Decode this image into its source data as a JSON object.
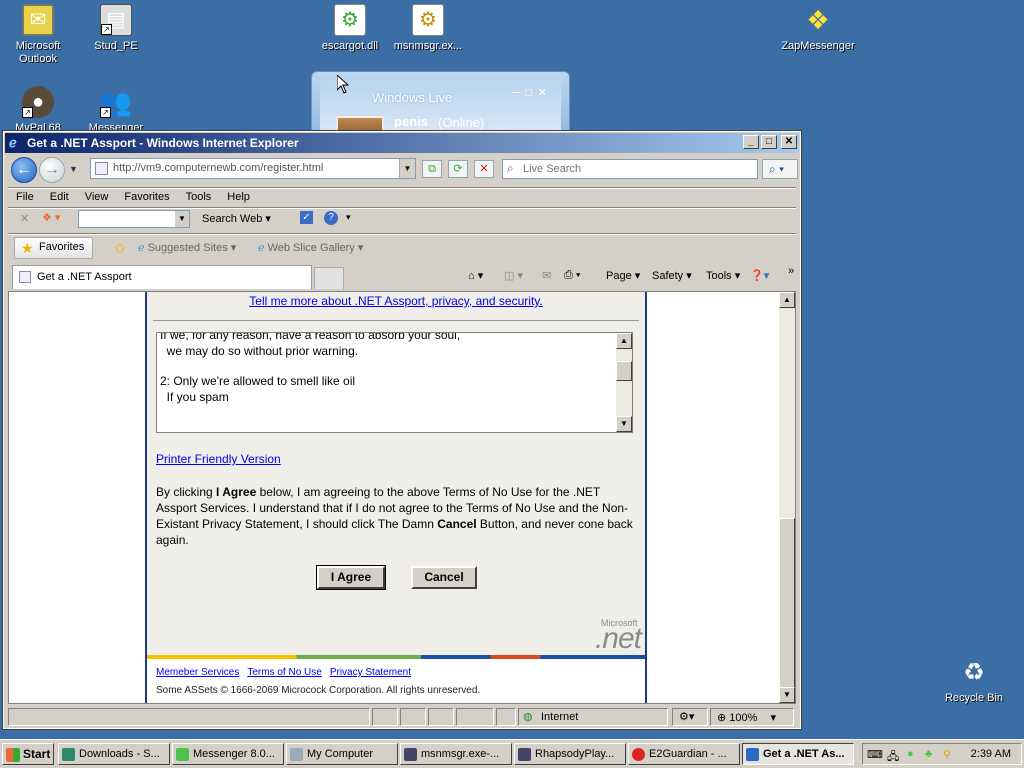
{
  "desktop": {
    "icons": [
      {
        "label": "Microsoft Outlook",
        "icon": "outlook-icon"
      },
      {
        "label": "Stud_PE",
        "icon": "stud-pe-icon"
      },
      {
        "label": "escargot.dll",
        "icon": "dll-file-icon"
      },
      {
        "label": "msnmsgr.ex...",
        "icon": "exe-file-icon"
      },
      {
        "label": "ZapMessenger",
        "icon": "zapmessenger-icon"
      },
      {
        "label": "MyPal 68",
        "icon": "mypal-icon"
      },
      {
        "label": "Messenger",
        "icon": "messenger-icon"
      },
      {
        "label": "Recycle Bin",
        "icon": "recycle-bin-icon"
      }
    ]
  },
  "messenger_window": {
    "title": "Windows Live",
    "user_name": "penis",
    "status": "(Online)"
  },
  "ie": {
    "title": "Get a .NET Assport - Windows Internet Explorer",
    "address": "http://vm9.computernewb.com/register.html",
    "search_placeholder": "Live Search",
    "menu": [
      "File",
      "Edit",
      "View",
      "Favorites",
      "Tools",
      "Help"
    ],
    "toolbar": {
      "search_web": "Search Web"
    },
    "favorites": {
      "label": "Favorites",
      "suggested_sites": "Suggested Sites",
      "web_slice_gallery": "Web Slice Gallery"
    },
    "tab_label": "Get a .NET Assport",
    "commands": {
      "page": "Page",
      "safety": "Safety",
      "tools": "Tools"
    },
    "status": {
      "zone": "Internet",
      "zoom": "100%"
    }
  },
  "page": {
    "tell_more_link": "Tell me more about .NET Assport, privacy, and security.",
    "terms_lines": [
      "If we, for any reason, have a reason to absorb your soul,",
      "  we may do so without prior warning.",
      "",
      "2: Only we're allowed to smell like oil",
      "  If you spam"
    ],
    "printer_link": "Printer Friendly Version",
    "agree_text": {
      "p1": "By clicking ",
      "bold1": "I Agree",
      "p2": " below, I am agreeing to the above Terms of No Use for the .NET Assport Services. I understand that if I do not agree to the Terms of No Use and the Non-Existant Privacy Statement, I should click The Damn ",
      "bold2": "Cancel",
      "p3": " Button, and never cone back again."
    },
    "agree_button": "I Agree",
    "cancel_button": "Cancel",
    "logo_small": "Microsoft",
    "logo_big": ".net",
    "footer_links": [
      "Memeber Services",
      "Terms of No Use",
      "Privacy Statement"
    ],
    "copyright": "Some ASSets © 1666-2069 Microcock Corporation. All rights unreserved."
  },
  "taskbar": {
    "start": "Start",
    "tasks": [
      "Downloads - S...",
      "Messenger 8.0...",
      "My Computer",
      "msnmsgr.exe-...",
      "RhapsodyPlay...",
      "E2Guardian - ...",
      "Get a .NET As..."
    ],
    "clock": "2:39 AM"
  }
}
